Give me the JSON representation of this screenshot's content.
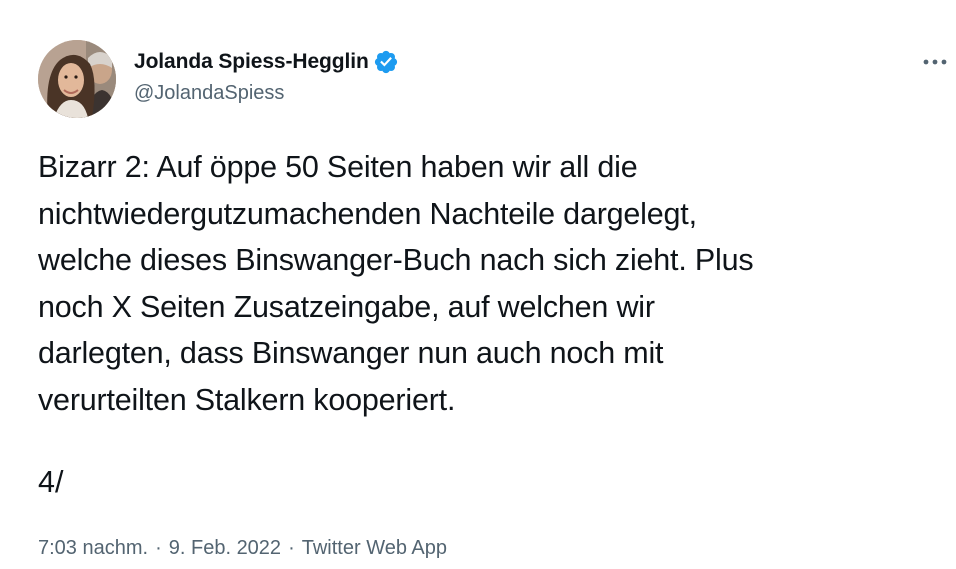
{
  "author": {
    "display_name": "Jolanda Spiess-Hegglin",
    "handle": "@JolandaSpiess",
    "verified": true
  },
  "tweet": {
    "text": "Bizarr 2: Auf öppe 50 Seiten haben wir all die\nnichtwiedergutzumachenden Nachteile dargelegt,\nwelche dieses Binswanger-Buch nach sich zieht. Plus\nnoch X Seiten Zusatzeingabe, auf welchen wir\ndarlegten, dass Binswanger nun auch noch mit\nverurteilten Stalkern kooperiert.",
    "thread_marker": "4/"
  },
  "meta": {
    "time": "7:03 nachm.",
    "separator": "·",
    "date": "9. Feb. 2022",
    "source": "Twitter Web App"
  },
  "icons": {
    "verified": "verified-badge-icon",
    "more": "more-options-icon"
  },
  "colors": {
    "verified_blue": "#1d9bf0",
    "text_primary": "#0f1419",
    "text_secondary": "#536471"
  }
}
